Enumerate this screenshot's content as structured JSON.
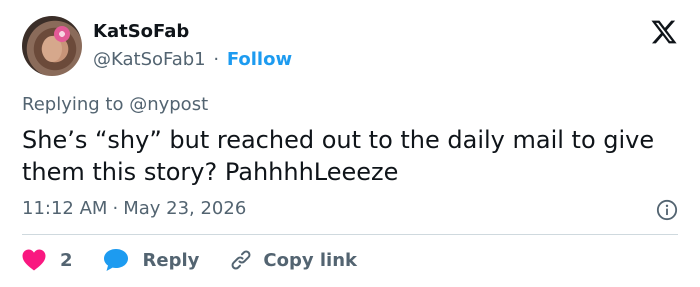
{
  "author": {
    "name": "KatSoFab",
    "handle": "@KatSoFab1",
    "separator": "·",
    "follow_label": "Follow"
  },
  "reply_context": "Replying to @nypost",
  "tweet": {
    "text": "She’s “shy” but reached out to the daily mail to give them this story? PahhhhLeeeze"
  },
  "meta": {
    "time": "11:12 AM",
    "separator": "·",
    "date": "May 23, 2026"
  },
  "actions": {
    "like_count": "2",
    "reply_label": "Reply",
    "copy_label": "Copy link"
  },
  "icons": {
    "logo": "x-logo-icon",
    "info": "info-icon",
    "like": "heart-icon",
    "reply": "speech-bubble-icon",
    "copy": "link-icon"
  },
  "colors": {
    "accent": "#1d9bf0",
    "like": "#f91880",
    "text_primary": "#0f1419",
    "text_secondary": "#536471",
    "divider": "#cfd9de"
  }
}
